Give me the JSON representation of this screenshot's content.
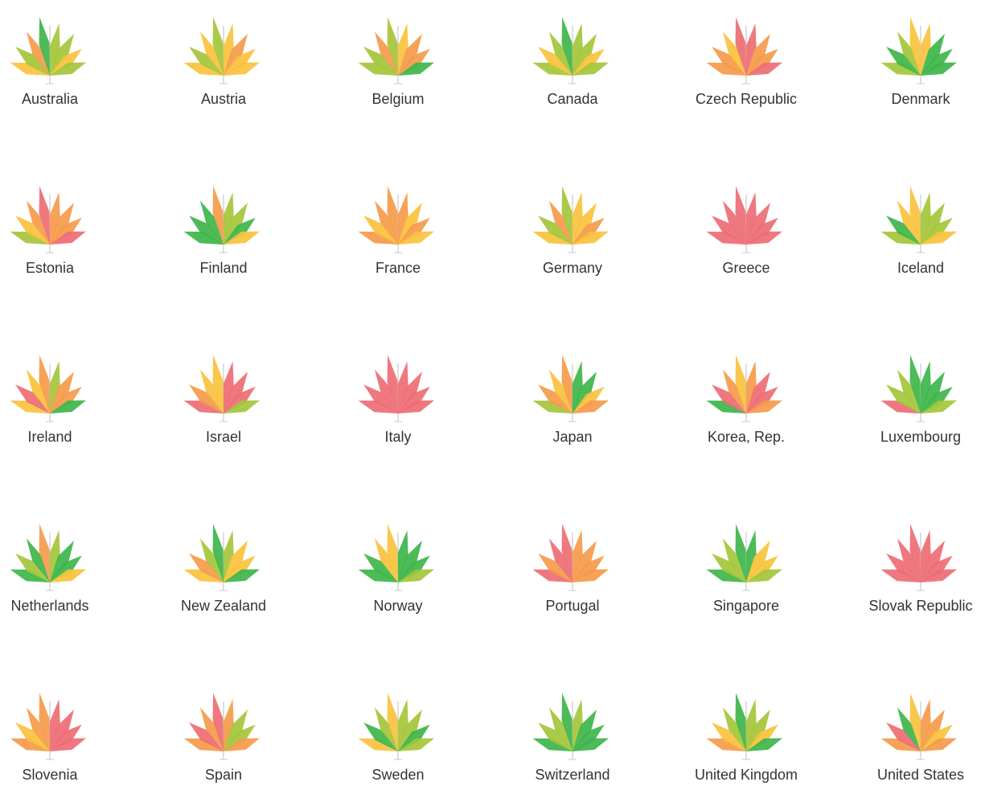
{
  "colors": {
    "green": "#3DB54A",
    "lime": "#A4C639",
    "yellow": "#F9C23C",
    "orange": "#F59A4A",
    "red": "#EE6C74",
    "stem": "#C8C8C8"
  },
  "countries": [
    {
      "name": "Australia",
      "petals": [
        "yellow",
        "lime",
        "orange",
        "green",
        "lime",
        "lime",
        "yellow",
        "lime",
        "lime"
      ]
    },
    {
      "name": "Austria",
      "petals": [
        "yellow",
        "lime",
        "yellow",
        "lime",
        "yellow",
        "orange",
        "yellow",
        "yellow",
        "yellow"
      ]
    },
    {
      "name": "Belgium",
      "petals": [
        "lime",
        "lime",
        "orange",
        "lime",
        "yellow",
        "orange",
        "orange",
        "green",
        "green"
      ]
    },
    {
      "name": "Canada",
      "petals": [
        "lime",
        "yellow",
        "lime",
        "green",
        "lime",
        "lime",
        "yellow",
        "lime",
        "lime"
      ]
    },
    {
      "name": "Czech Republic",
      "petals": [
        "orange",
        "orange",
        "yellow",
        "red",
        "red",
        "orange",
        "orange",
        "red",
        "red"
      ]
    },
    {
      "name": "Denmark",
      "petals": [
        "lime",
        "green",
        "lime",
        "yellow",
        "yellow",
        "green",
        "green",
        "green",
        "green"
      ]
    },
    {
      "name": "Estonia",
      "petals": [
        "lime",
        "yellow",
        "orange",
        "red",
        "orange",
        "orange",
        "orange",
        "red",
        "red"
      ]
    },
    {
      "name": "Finland",
      "petals": [
        "green",
        "green",
        "green",
        "orange",
        "lime",
        "lime",
        "green",
        "yellow",
        "yellow"
      ]
    },
    {
      "name": "France",
      "petals": [
        "orange",
        "yellow",
        "orange",
        "orange",
        "orange",
        "yellow",
        "orange",
        "yellow",
        "yellow"
      ]
    },
    {
      "name": "Germany",
      "petals": [
        "yellow",
        "lime",
        "orange",
        "lime",
        "yellow",
        "yellow",
        "orange",
        "yellow",
        "yellow"
      ]
    },
    {
      "name": "Greece",
      "petals": [
        "red",
        "red",
        "red",
        "red",
        "red",
        "red",
        "red",
        "red",
        "red"
      ]
    },
    {
      "name": "Iceland",
      "petals": [
        "lime",
        "green",
        "yellow",
        "yellow",
        "lime",
        "lime",
        "lime",
        "yellow",
        "yellow"
      ]
    },
    {
      "name": "Ireland",
      "petals": [
        "yellow",
        "red",
        "yellow",
        "orange",
        "lime",
        "orange",
        "orange",
        "green",
        "green"
      ]
    },
    {
      "name": "Israel",
      "petals": [
        "red",
        "orange",
        "yellow",
        "yellow",
        "red",
        "red",
        "red",
        "lime",
        "lime"
      ]
    },
    {
      "name": "Italy",
      "petals": [
        "red",
        "red",
        "red",
        "red",
        "red",
        "red",
        "red",
        "red",
        "red"
      ]
    },
    {
      "name": "Japan",
      "petals": [
        "lime",
        "orange",
        "yellow",
        "orange",
        "green",
        "green",
        "yellow",
        "orange",
        "orange"
      ]
    },
    {
      "name": "Korea, Rep.",
      "petals": [
        "green",
        "red",
        "orange",
        "yellow",
        "orange",
        "red",
        "red",
        "orange",
        "orange"
      ]
    },
    {
      "name": "Luxembourg",
      "petals": [
        "red",
        "lime",
        "lime",
        "green",
        "green",
        "green",
        "green",
        "lime",
        "lime"
      ]
    },
    {
      "name": "Netherlands",
      "petals": [
        "green",
        "lime",
        "green",
        "orange",
        "lime",
        "green",
        "green",
        "yellow",
        "yellow"
      ]
    },
    {
      "name": "New Zealand",
      "petals": [
        "yellow",
        "orange",
        "lime",
        "green",
        "lime",
        "yellow",
        "yellow",
        "green",
        "green"
      ]
    },
    {
      "name": "Norway",
      "petals": [
        "green",
        "green",
        "yellow",
        "yellow",
        "green",
        "green",
        "green",
        "lime",
        "lime"
      ]
    },
    {
      "name": "Portugal",
      "petals": [
        "red",
        "orange",
        "red",
        "red",
        "orange",
        "orange",
        "orange",
        "orange",
        "orange"
      ]
    },
    {
      "name": "Singapore",
      "petals": [
        "green",
        "lime",
        "lime",
        "green",
        "green",
        "yellow",
        "yellow",
        "lime",
        "lime"
      ]
    },
    {
      "name": "Slovak Republic",
      "petals": [
        "red",
        "red",
        "red",
        "red",
        "red",
        "red",
        "red",
        "red",
        "red"
      ]
    },
    {
      "name": "Slovenia",
      "petals": [
        "orange",
        "yellow",
        "orange",
        "orange",
        "red",
        "red",
        "red",
        "red",
        "red"
      ]
    },
    {
      "name": "Spain",
      "petals": [
        "orange",
        "red",
        "orange",
        "red",
        "orange",
        "lime",
        "lime",
        "orange",
        "orange"
      ]
    },
    {
      "name": "Sweden",
      "petals": [
        "yellow",
        "green",
        "lime",
        "yellow",
        "lime",
        "lime",
        "green",
        "lime",
        "lime"
      ]
    },
    {
      "name": "Switzerland",
      "petals": [
        "green",
        "lime",
        "lime",
        "green",
        "lime",
        "green",
        "green",
        "green",
        "green"
      ]
    },
    {
      "name": "United Kingdom",
      "petals": [
        "orange",
        "yellow",
        "lime",
        "green",
        "lime",
        "lime",
        "yellow",
        "green",
        "green"
      ]
    },
    {
      "name": "United States",
      "petals": [
        "orange",
        "red",
        "green",
        "yellow",
        "orange",
        "orange",
        "yellow",
        "orange",
        "orange"
      ]
    }
  ]
}
